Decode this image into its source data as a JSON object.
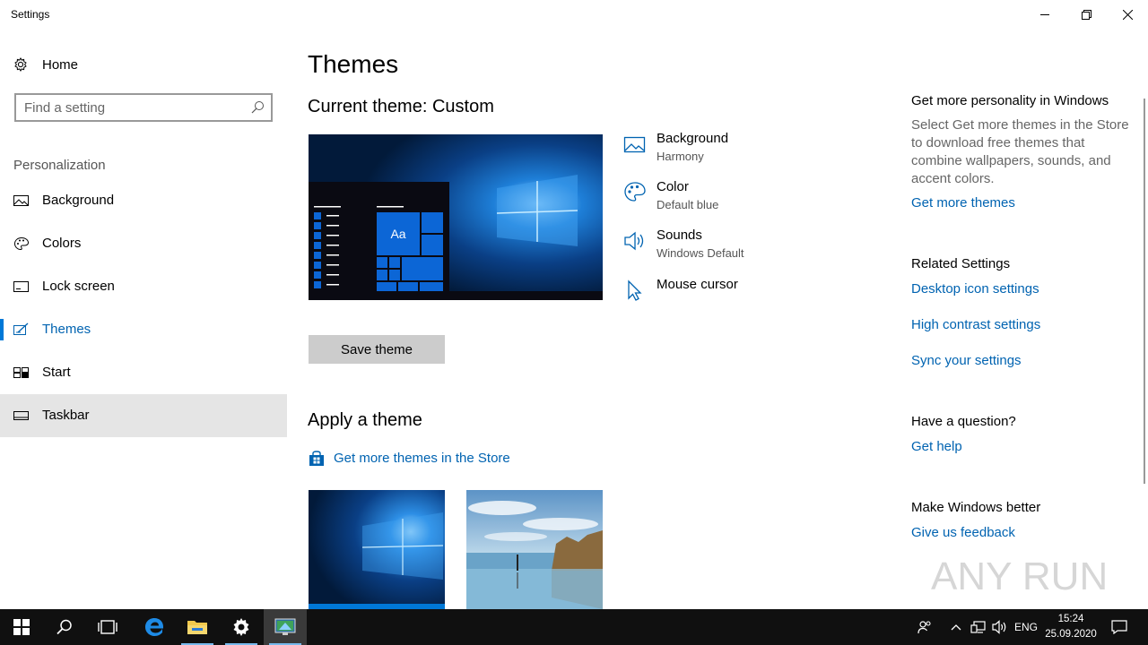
{
  "window": {
    "title": "Settings"
  },
  "sidebar": {
    "home_label": "Home",
    "search_placeholder": "Find a setting",
    "section_header": "Personalization",
    "items": [
      {
        "label": "Background",
        "icon": "picture-icon"
      },
      {
        "label": "Colors",
        "icon": "palette-icon"
      },
      {
        "label": "Lock screen",
        "icon": "lock-screen-icon"
      },
      {
        "label": "Themes",
        "icon": "themes-icon",
        "active": true
      },
      {
        "label": "Start",
        "icon": "start-icon"
      },
      {
        "label": "Taskbar",
        "icon": "taskbar-icon",
        "hovered": true
      }
    ]
  },
  "main": {
    "title": "Themes",
    "current_theme": "Current theme: Custom",
    "preview_tile_label": "Aa",
    "properties": [
      {
        "title": "Background",
        "subtitle": "Harmony",
        "icon": "picture-icon"
      },
      {
        "title": "Color",
        "subtitle": "Default blue",
        "icon": "palette-icon"
      },
      {
        "title": "Sounds",
        "subtitle": "Windows Default",
        "icon": "speaker-icon"
      },
      {
        "title": "Mouse cursor",
        "subtitle": "",
        "icon": "cursor-icon"
      }
    ],
    "save_button": "Save theme",
    "apply_header": "Apply a theme",
    "store_link": "Get more themes in the Store"
  },
  "right": {
    "personality_header": "Get more personality in Windows",
    "personality_text": "Select Get more themes in the Store to download free themes that combine wallpapers, sounds, and accent colors.",
    "get_more_themes": "Get more themes",
    "related_header": "Related Settings",
    "related_links": [
      "Desktop icon settings",
      "High contrast settings",
      "Sync your settings"
    ],
    "question_header": "Have a question?",
    "get_help": "Get help",
    "better_header": "Make Windows better",
    "feedback": "Give us feedback"
  },
  "watermark": "ANY RUN",
  "taskbar": {
    "language": "ENG",
    "time": "15:24",
    "date": "25.09.2020"
  },
  "colors": {
    "accent": "#0078d7",
    "link": "#0063b1",
    "taskbar": "#101010"
  }
}
